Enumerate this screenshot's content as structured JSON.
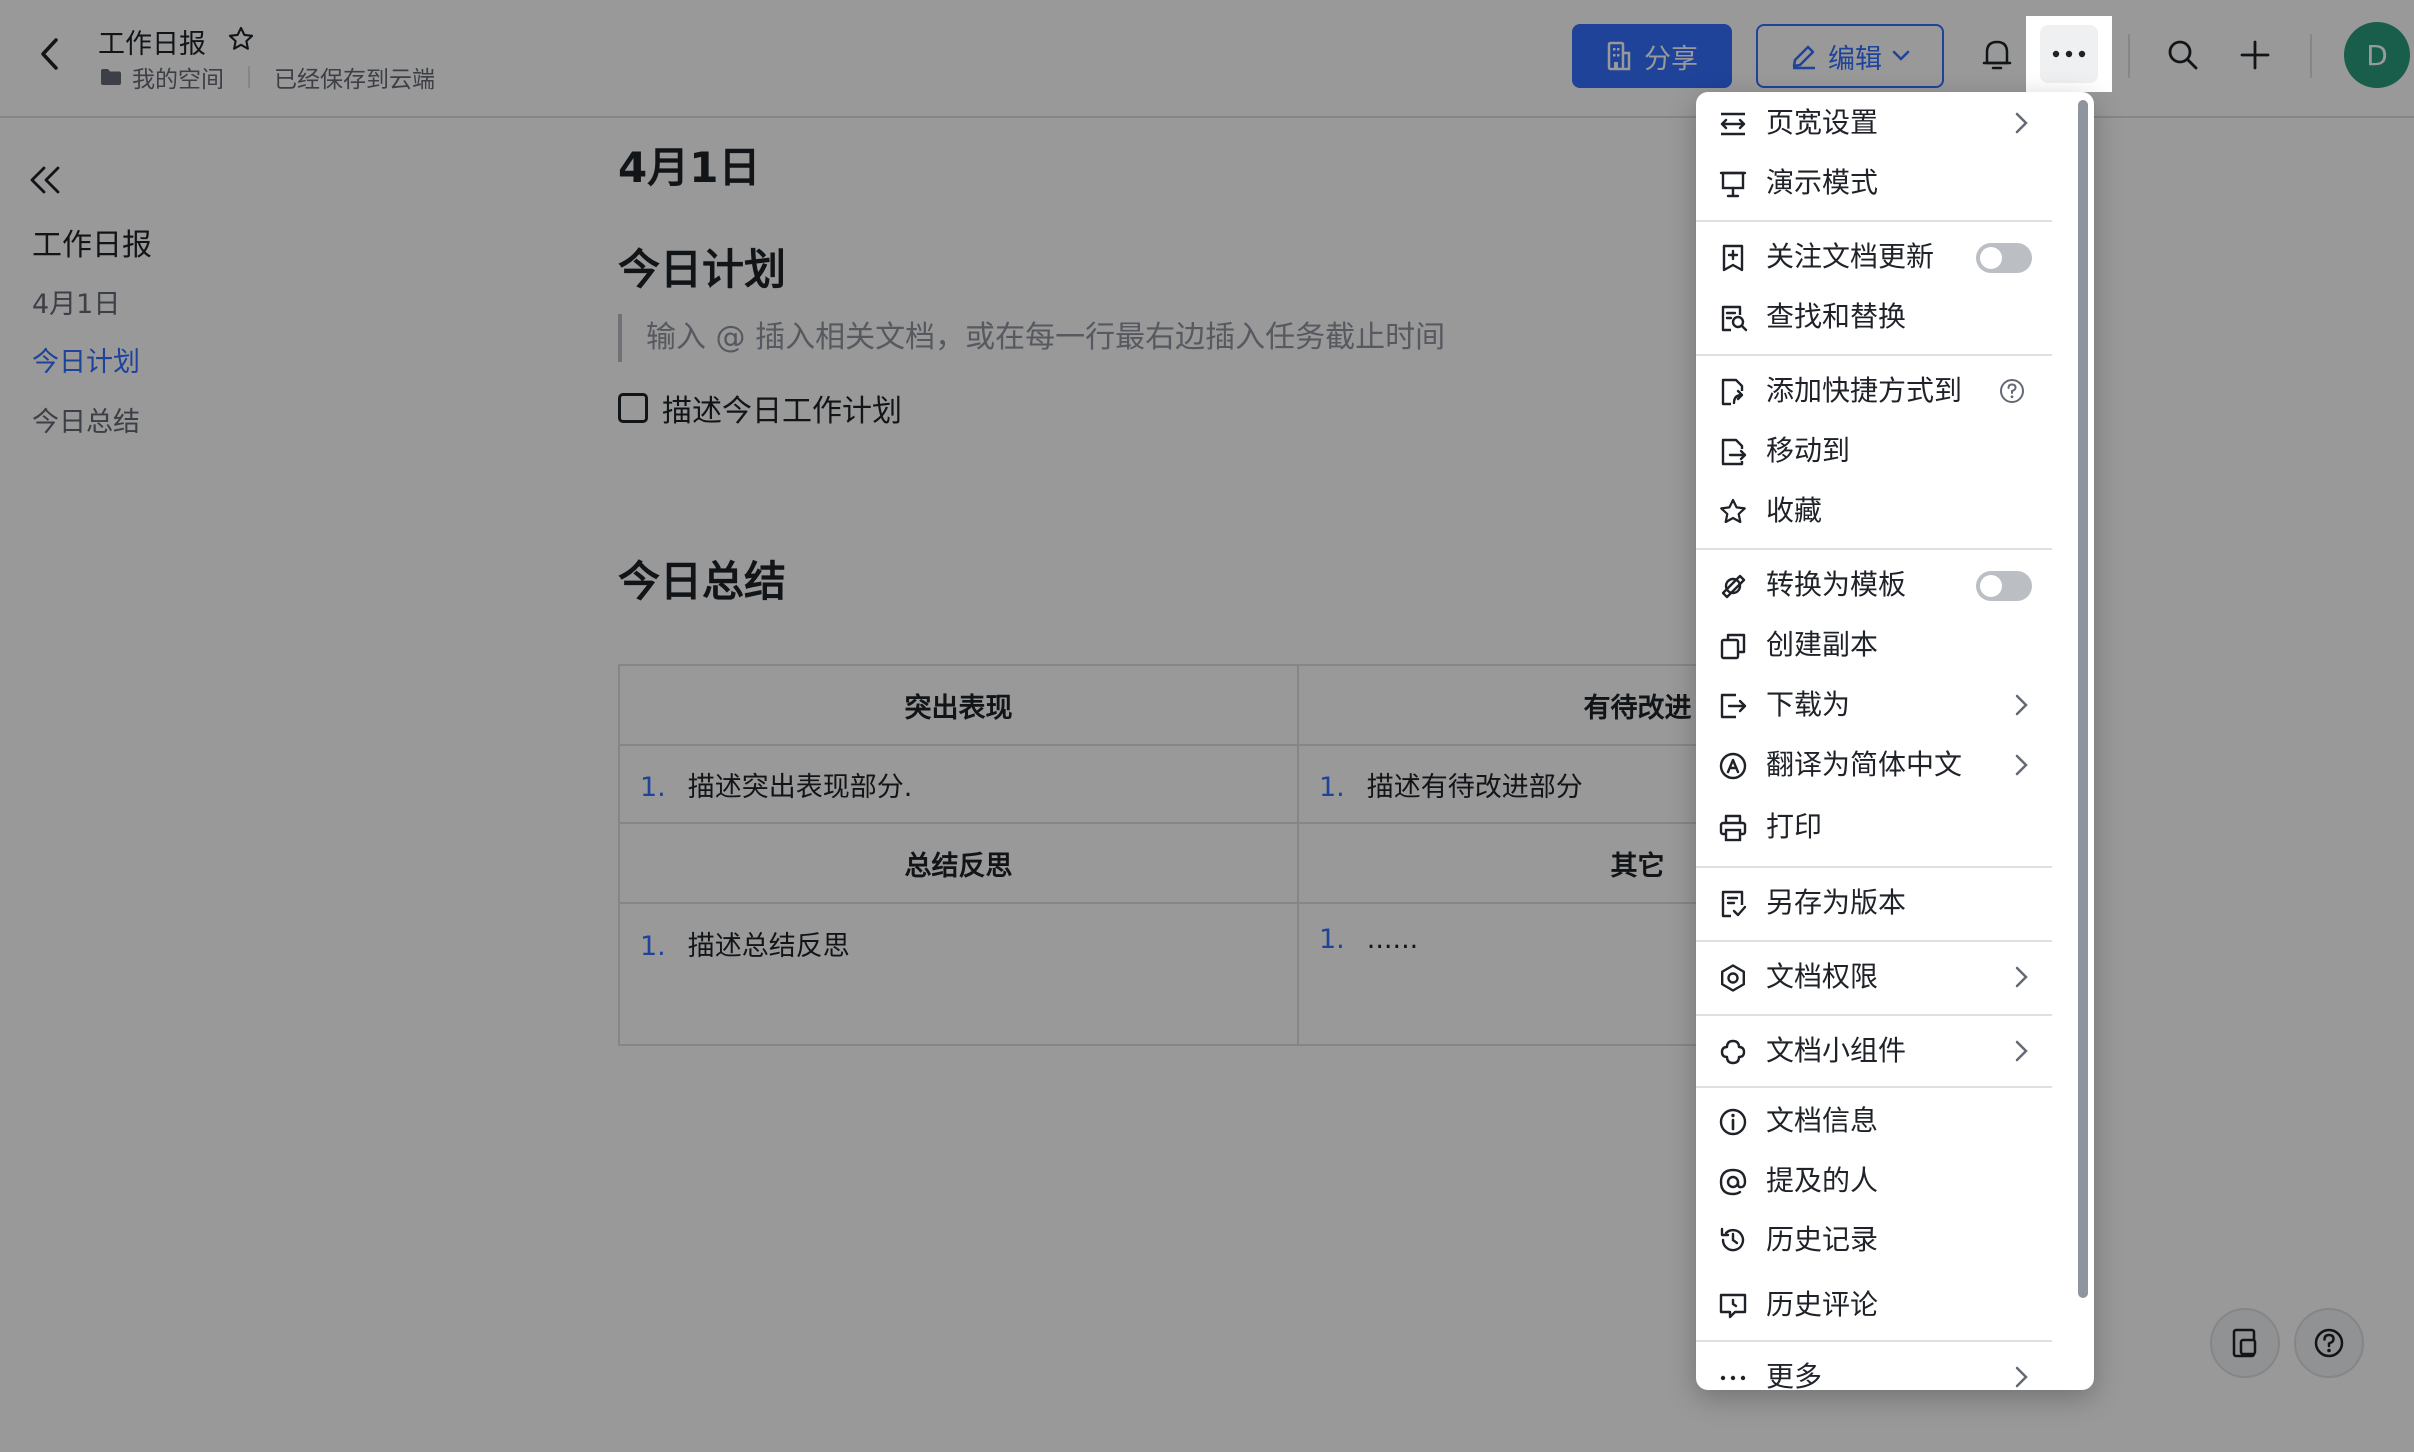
{
  "header": {
    "title": "工作日报",
    "breadcrumb_space": "我的空间",
    "save_status": "已经保存到云端",
    "share_label": "分享",
    "edit_label": "编辑",
    "avatar_initial": "D"
  },
  "sidebar": {
    "toc_title": "工作日报",
    "items": [
      "4月1日",
      "今日计划",
      "今日总结"
    ]
  },
  "doc": {
    "date_heading": "4月1日",
    "plan_heading": "今日计划",
    "plan_placeholder": "输入 @ 插入相关文档，或在每一行最右边插入任务截止时间",
    "todo_item": "描述今日工作计划",
    "summary_heading": "今日总结",
    "table": {
      "headers_row1": [
        "突出表现",
        "有待改进"
      ],
      "row1": [
        "描述突出表现部分.",
        "描述有待改进部分"
      ],
      "headers_row2": [
        "总结反思",
        "其它"
      ],
      "row2": [
        "描述总结反思",
        "......"
      ],
      "list_marker": "1."
    }
  },
  "menu": {
    "items": [
      {
        "label": "页宽设置",
        "icon": "page-width-icon"
      },
      {
        "label": "演示模式",
        "icon": "presentation-icon"
      },
      {
        "label": "关注文档更新",
        "icon": "follow-update-icon",
        "toggle": false
      },
      {
        "label": "查找和替换",
        "icon": "find-replace-icon"
      },
      {
        "label": "添加快捷方式到",
        "icon": "shortcut-icon"
      },
      {
        "label": "移动到",
        "icon": "move-icon"
      },
      {
        "label": "收藏",
        "icon": "star-icon"
      },
      {
        "label": "转换为模板",
        "icon": "template-icon",
        "toggle": false
      },
      {
        "label": "创建副本",
        "icon": "copy-icon"
      },
      {
        "label": "下载为",
        "icon": "download-icon"
      },
      {
        "label": "翻译为简体中文",
        "icon": "translate-icon"
      },
      {
        "label": "打印",
        "icon": "print-icon"
      },
      {
        "label": "另存为版本",
        "icon": "save-version-icon"
      },
      {
        "label": "文档权限",
        "icon": "gear-icon"
      },
      {
        "label": "文档小组件",
        "icon": "widget-icon"
      },
      {
        "label": "文档信息",
        "icon": "info-icon"
      },
      {
        "label": "提及的人",
        "icon": "at-icon"
      },
      {
        "label": "历史记录",
        "icon": "history-icon",
        "highlighted": true
      },
      {
        "label": "历史评论",
        "icon": "comment-history-icon"
      },
      {
        "label": "更多",
        "icon": "more-dots-icon"
      }
    ]
  }
}
